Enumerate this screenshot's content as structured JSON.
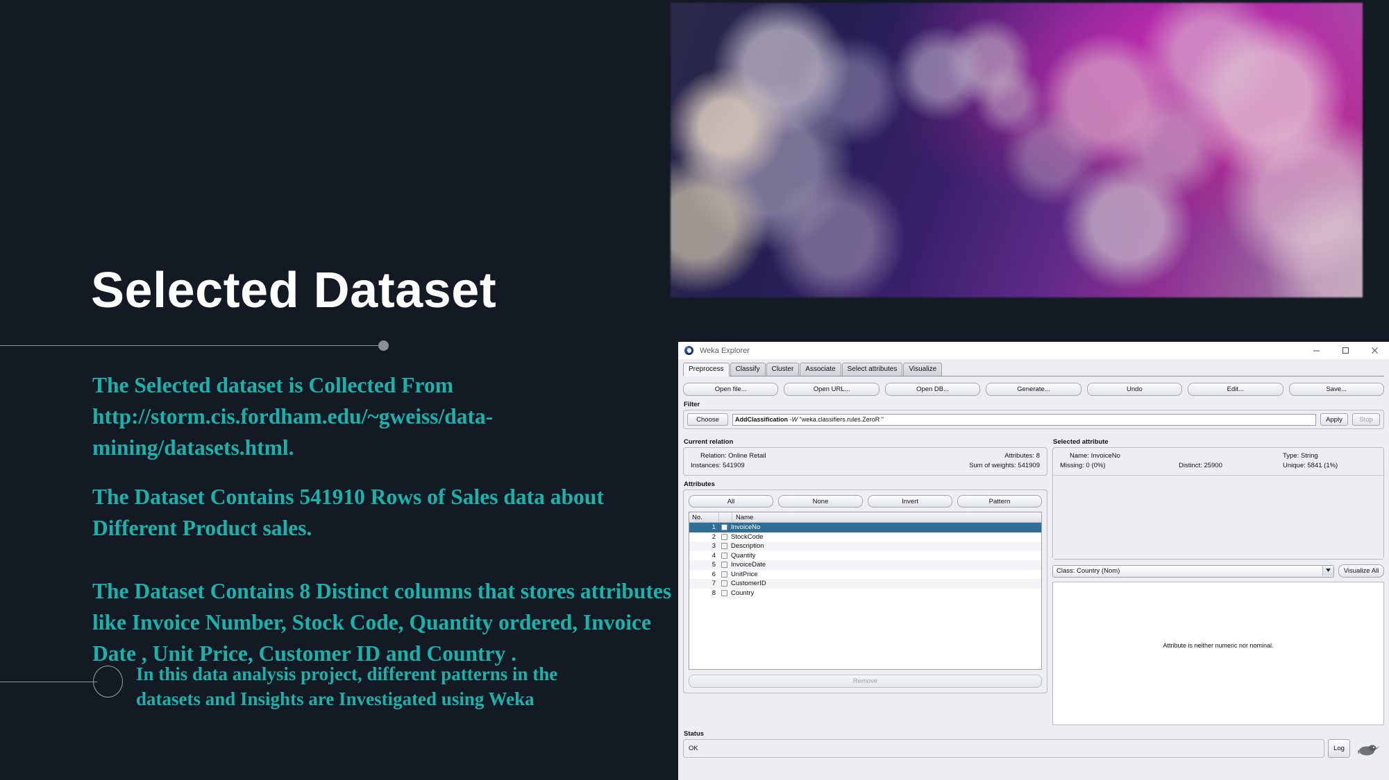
{
  "slide": {
    "title": "Selected Dataset",
    "paragraphs": [
      "The Selected dataset is Collected From http://storm.cis.fordham.edu/~gweiss/data-mining/datasets.html.",
      "The Dataset Contains 541910 Rows of Sales data about Different Product  sales.",
      "The Dataset Contains 8 Distinct  columns that stores attributes like Invoice Number, Stock Code, Quantity  ordered, Invoice Date , Unit Price, Customer ID  and Country ."
    ],
    "bullet": "In this data analysis project, different patterns in the datasets and Insights are Investigated using Weka",
    "accent_color": "#18b3ac",
    "background_color": "#131a24",
    "title_color": "#ffffff"
  },
  "weka": {
    "window_title": "Weka Explorer",
    "window_controls": {
      "minimize": "minimize-icon",
      "maximize": "maximize-icon",
      "close": "close-icon"
    },
    "tabs": [
      {
        "label": "Preprocess",
        "active": true
      },
      {
        "label": "Classify",
        "active": false
      },
      {
        "label": "Cluster",
        "active": false
      },
      {
        "label": "Associate",
        "active": false
      },
      {
        "label": "Select attributes",
        "active": false
      },
      {
        "label": "Visualize",
        "active": false
      }
    ],
    "toolbar": [
      "Open file...",
      "Open URL...",
      "Open DB...",
      "Generate...",
      "Undo",
      "Edit...",
      "Save..."
    ],
    "filter": {
      "label": "Filter",
      "choose_label": "Choose",
      "value_bold": "AddClassification",
      "value_flag": "-W",
      "value_rest": "\"weka.classifiers.rules.ZeroR \"",
      "apply_label": "Apply",
      "stop_label": "Stop"
    },
    "current_relation": {
      "label": "Current relation",
      "relation_key": "Relation:",
      "relation_value": "Online Retail",
      "instances_key": "Instances:",
      "instances_value": "541909",
      "attributes_key": "Attributes:",
      "attributes_value": "8",
      "weights_key": "Sum of weights:",
      "weights_value": "541909"
    },
    "attributes_panel": {
      "label": "Attributes",
      "buttons": [
        "All",
        "None",
        "Invert",
        "Pattern"
      ],
      "columns": [
        "No.",
        "Name"
      ],
      "rows": [
        {
          "no": "1",
          "name": "InvoiceNo",
          "selected": true
        },
        {
          "no": "2",
          "name": "StockCode",
          "selected": false
        },
        {
          "no": "3",
          "name": "Description",
          "selected": false
        },
        {
          "no": "4",
          "name": "Quantity",
          "selected": false
        },
        {
          "no": "5",
          "name": "InvoiceDate",
          "selected": false
        },
        {
          "no": "6",
          "name": "UnitPrice",
          "selected": false
        },
        {
          "no": "7",
          "name": "CustomerID",
          "selected": false
        },
        {
          "no": "8",
          "name": "Country",
          "selected": false
        }
      ],
      "remove_label": "Remove"
    },
    "selected_attribute": {
      "label": "Selected attribute",
      "name_key": "Name:",
      "name_value": "InvoiceNo",
      "type_key": "Type:",
      "type_value": "String",
      "missing_key": "Missing:",
      "missing_value": "0 (0%)",
      "distinct_key": "Distinct:",
      "distinct_value": "25900",
      "unique_key": "Unique:",
      "unique_value": "5841 (1%)"
    },
    "class_selector": {
      "value": "Class: Country (Nom)",
      "visualize_all_label": "Visualize All"
    },
    "plot_message": "Attribute is neither numeric nor nominal.",
    "status": {
      "label": "Status",
      "value": "OK",
      "log_label": "Log",
      "bird_icon": "weka-bird-icon"
    }
  }
}
